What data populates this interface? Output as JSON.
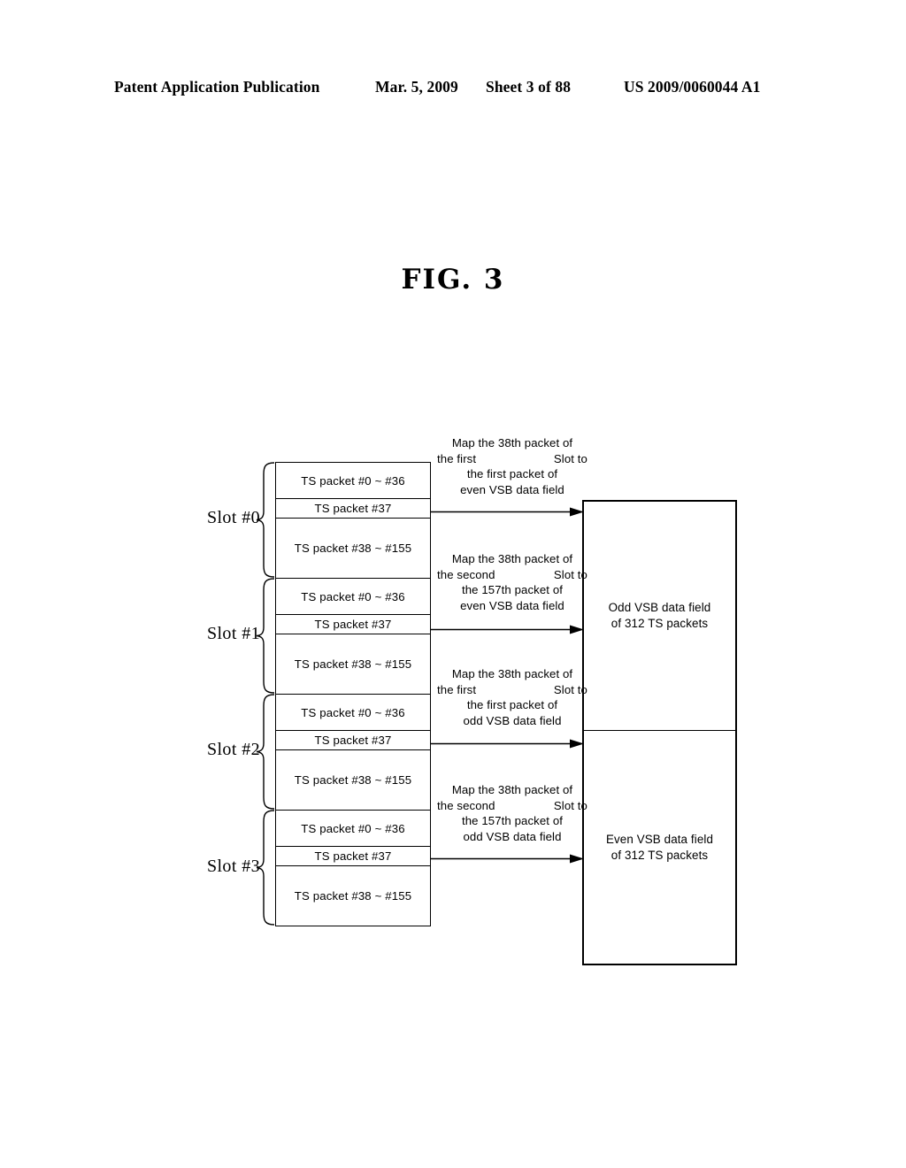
{
  "header": {
    "publication": "Patent Application Publication",
    "date": "Mar. 5, 2009",
    "sheet": "Sheet 3 of 88",
    "patent_number": "US 2009/0060044 A1"
  },
  "figure": {
    "title": "FIG. 3"
  },
  "slots": [
    {
      "label": "Slot #0",
      "rows": [
        "TS packet #0 ~ #36",
        "TS packet #37",
        "TS packet #38 ~ #155"
      ]
    },
    {
      "label": "Slot #1",
      "rows": [
        "TS packet #0 ~ #36",
        "TS packet #37",
        "TS packet #38 ~ #155"
      ]
    },
    {
      "label": "Slot #2",
      "rows": [
        "TS packet #0 ~ #36",
        "TS packet #37",
        "TS packet #38 ~ #155"
      ]
    },
    {
      "label": "Slot #3",
      "rows": [
        "TS packet #0 ~ #36",
        "TS packet #37",
        "TS packet #38 ~ #155"
      ]
    }
  ],
  "annotations": [
    {
      "line1": "Map the 38th packet of",
      "line2_left": "the first",
      "line2_right": "Slot to",
      "line3": "the first packet of",
      "line4": "even VSB  data field"
    },
    {
      "line1": "Map the 38th packet of",
      "line2_left": "the second",
      "line2_right": "Slot to",
      "line3": "the 157th packet of",
      "line4": "even VSB data field"
    },
    {
      "line1": "Map the 38th packet of",
      "line2_left": "the first",
      "line2_right": "Slot to",
      "line3": "the first packet of",
      "line4": "odd VSB  data field"
    },
    {
      "line1": "Map the 38th packet of",
      "line2_left": "the second",
      "line2_right": "Slot to",
      "line3": "the 157th packet of",
      "line4": "odd VSB data field"
    }
  ],
  "vsb_fields": [
    {
      "line1": "Odd VSB data field",
      "line2": "of 312 TS packets"
    },
    {
      "line1": "Even VSB data field",
      "line2": "of 312 TS packets"
    }
  ],
  "colors": {
    "ink": "#000000",
    "paper": "#ffffff"
  }
}
